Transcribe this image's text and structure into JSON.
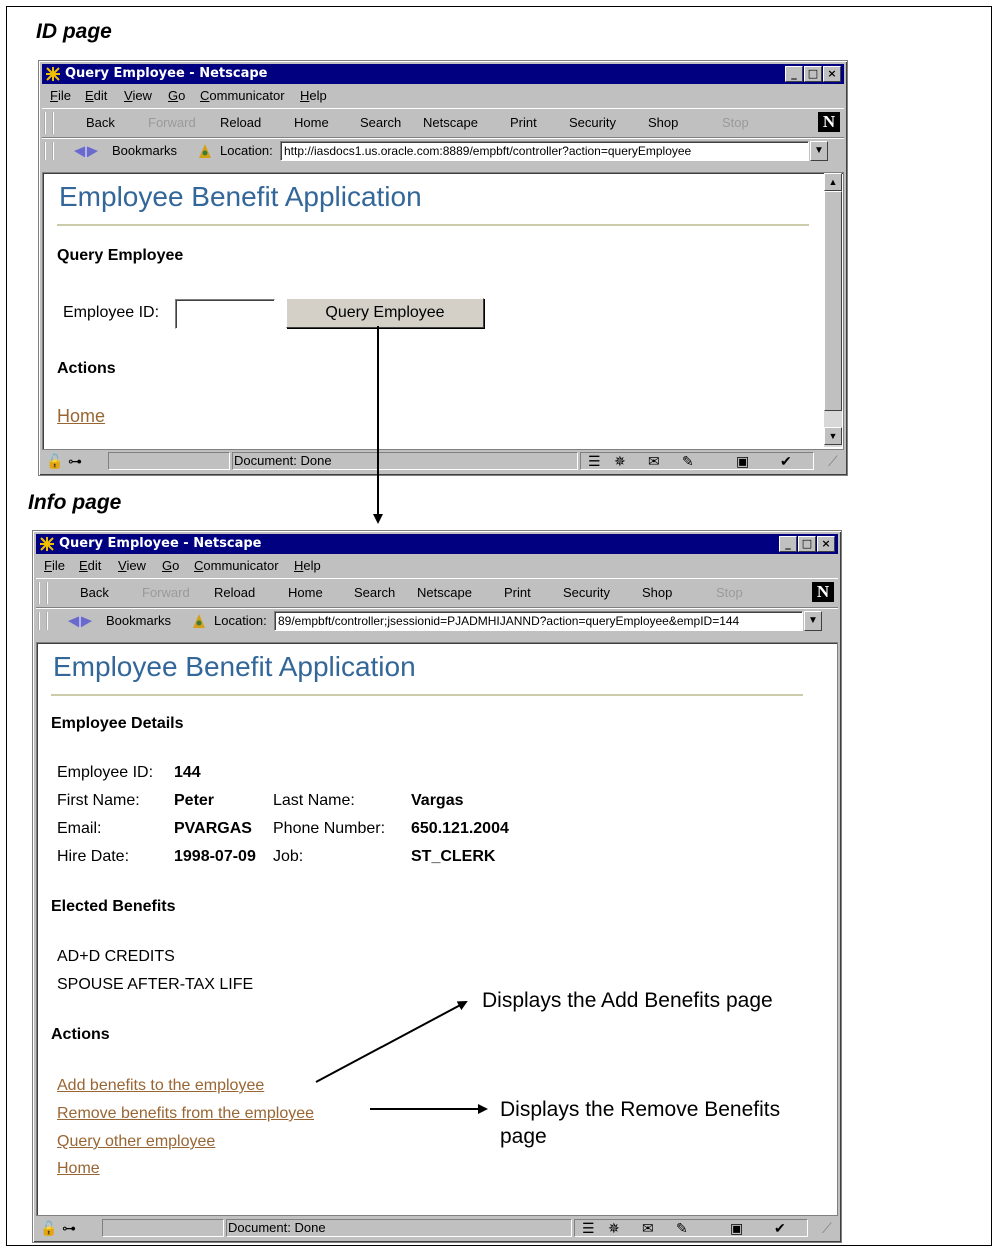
{
  "captions": {
    "id_page": "ID page",
    "info_page": "Info page"
  },
  "browser": {
    "title": "Query Employee - Netscape",
    "title_buttons": [
      "_",
      "□",
      "×"
    ],
    "menu": [
      "File",
      "Edit",
      "View",
      "Go",
      "Communicator",
      "Help"
    ],
    "toolbar": [
      "Back",
      "Forward",
      "Reload",
      "Home",
      "Search",
      "Netscape",
      "Print",
      "Security",
      "Shop",
      "Stop"
    ],
    "toolbar_disabled": [
      "Forward",
      "Stop"
    ],
    "bookmarks_label": "Bookmarks",
    "location_label": "Location:",
    "status_text": "Document: Done",
    "logo_letter": "N"
  },
  "id_page": {
    "location_url": "http://iasdocs1.us.oracle.com:8889/empbft/controller?action=queryEmployee",
    "app_title": "Employee Benefit Application",
    "section_query": "Query Employee",
    "employee_id_label": "Employee ID:",
    "employee_id_value": "",
    "query_button": "Query Employee",
    "section_actions": "Actions",
    "home_link": "Home"
  },
  "info_page": {
    "location_url": "89/empbft/controller;jsessionid=PJADMHIJANND?action=queryEmployee&empID=144",
    "app_title": "Employee Benefit Application",
    "section_details": "Employee Details",
    "details": {
      "employee_id_label": "Employee ID:",
      "employee_id": "144",
      "first_name_label": "First Name:",
      "first_name": "Peter",
      "last_name_label": "Last Name:",
      "last_name": "Vargas",
      "email_label": "Email:",
      "email": "PVARGAS",
      "phone_label": "Phone Number:",
      "phone": "650.121.2004",
      "hire_date_label": "Hire Date:",
      "hire_date": "1998-07-09",
      "job_label": "Job:",
      "job": "ST_CLERK"
    },
    "section_benefits": "Elected Benefits",
    "benefits": [
      "AD+D CREDITS",
      "SPOUSE AFTER-TAX LIFE"
    ],
    "section_actions": "Actions",
    "links": [
      "Add benefits to the employee",
      "Remove benefits from the employee",
      "Query other employee",
      "Home"
    ]
  },
  "annotations": {
    "add": "Displays the Add Benefits page",
    "remove_line1": "Displays the Remove Benefits",
    "remove_line2": "page"
  }
}
